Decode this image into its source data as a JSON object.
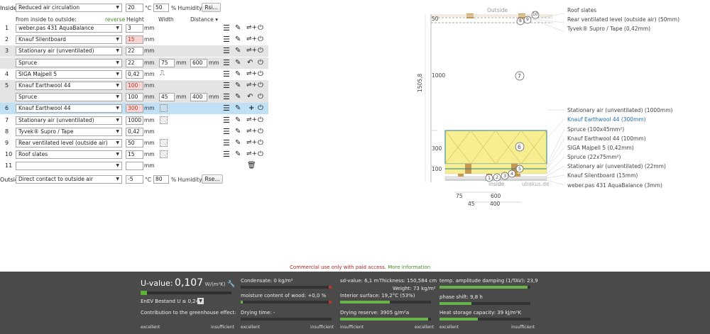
{
  "inside": {
    "label": "Inside:",
    "select": "Reduced air circulation",
    "temp": "20",
    "temp_unit": "°C",
    "humidity": "50",
    "hum_unit": "% Humidity",
    "btn": "Rsi..."
  },
  "headers": {
    "from_inside": "From inside to outside:",
    "reverse": "reverse",
    "height": "Height",
    "width": "Width",
    "distance": "Distance"
  },
  "layers": [
    {
      "num": "1",
      "material": "weber.pas 431 AquaBalance",
      "height": "3",
      "unit": "mm",
      "red": false,
      "bg": "white",
      "sub": false,
      "icon": "none"
    },
    {
      "num": "2",
      "material": "Knauf Silentboard",
      "height": "15",
      "unit": "mm",
      "red": true,
      "bg": "white",
      "sub": false,
      "icon": "none"
    },
    {
      "num": "3",
      "material": "Stationary air (unventilated)",
      "height": "22",
      "unit": "mm",
      "red": false,
      "bg": "grey",
      "sub": false,
      "icon": "none"
    },
    {
      "num": "",
      "material": "Spruce",
      "height": "22",
      "unit": "mm",
      "width": "75",
      "distance": "600",
      "red": false,
      "bg": "grey",
      "sub": true,
      "icon": "none"
    },
    {
      "num": "4",
      "material": "SIGA Majpell 5",
      "height": "0,42",
      "unit": "mm",
      "red": false,
      "bg": "white",
      "sub": false,
      "icon": "membrane"
    },
    {
      "num": "5",
      "material": "Knauf Earthwool 44",
      "height": "100",
      "unit": "mm",
      "red": true,
      "bg": "grey",
      "sub": false,
      "icon": "none"
    },
    {
      "num": "",
      "material": "Spruce",
      "height": "100",
      "unit": "mm",
      "width": "45",
      "distance": "400",
      "red": false,
      "bg": "grey",
      "sub": true,
      "icon": "none"
    },
    {
      "num": "6",
      "material": "Knauf Earthwool 44",
      "height": "300",
      "unit": "mm",
      "red": true,
      "bg": "blue",
      "sub": false,
      "icon": "grid"
    },
    {
      "num": "7",
      "material": "Stationary air (unventilated)",
      "height": "1000",
      "unit": "mm",
      "red": false,
      "bg": "white",
      "sub": false,
      "icon": "grid"
    },
    {
      "num": "8",
      "material": "Tyvek® Supro / Tape",
      "height": "0,42",
      "unit": "mm",
      "red": false,
      "bg": "white",
      "sub": false,
      "icon": "none"
    },
    {
      "num": "9",
      "material": "Rear ventilated level (outside air)",
      "height": "50",
      "unit": "mm",
      "red": false,
      "bg": "white",
      "sub": false,
      "icon": "grid"
    },
    {
      "num": "10",
      "material": "Roof slates",
      "height": "15",
      "unit": "mm",
      "red": false,
      "bg": "white",
      "sub": false,
      "icon": "grid"
    },
    {
      "num": "11",
      "material": "",
      "height": "",
      "unit": "mm",
      "red": false,
      "bg": "white",
      "sub": false,
      "icon": "trash"
    }
  ],
  "outside": {
    "label": "Outside",
    "select": "Direct contact to outside air",
    "temp": "-5",
    "temp_unit": "°C",
    "humidity": "80",
    "hum_unit": "% Humidity",
    "btn": "Rse..."
  },
  "diagram": {
    "top_outside": "Outside",
    "bottom_inside": "inside",
    "watermark": "ubakus.de",
    "left_scale": {
      "v50": "50",
      "v1000": "1000",
      "v300": "300",
      "v100": "100",
      "total": "1505,8"
    },
    "dims": {
      "d75": "75",
      "d600": "600",
      "d45": "45",
      "d400": "400"
    },
    "labels_top": [
      "Roof slates",
      "Rear ventilated level (outside air) (50mm)",
      "Tyvek® Supro / Tape (0,42mm)"
    ],
    "labels_right": [
      "Stationary air (unventilated) (1000mm)",
      "Knauf Earthwool 44 (300mm)",
      "Spruce (100x45mm²)",
      "Knauf Earthwool 44 (100mm)",
      "SIGA Majpell 5 (0,42mm)",
      "Spruce (22x75mm²)",
      "Stationary air (unventilated) (22mm)",
      "Knauf Silentboard (15mm)",
      "weber.pas 431 AquaBalance (3mm)"
    ],
    "circle_numbers": {
      "c1": "1",
      "c2": "2",
      "c3": "3",
      "c4": "4",
      "c5": "5",
      "c6": "6",
      "c7": "7",
      "c8": "8",
      "c9": "9",
      "c10": "10"
    }
  },
  "notice": {
    "text": "Commercial use only with paid access.",
    "link": "More information"
  },
  "results": {
    "uvalue_label": "U-value:",
    "uvalue": "0,107",
    "uvalue_unit": "W/(m²K)",
    "enev": "EnEV Bestand U ≤ 0,24",
    "contribution": "Contribution to the greenhouse effect:",
    "excellent": "excellent",
    "insufficient": "insufficient",
    "condensate": "Condensate: 0 kg/m²",
    "moisture": "moisture content of wood: +0,0 %",
    "drying_time": "Drying time: -",
    "sd_value": "sd-value: 6,1 m",
    "thickness": "Thickness: 150,584 cm",
    "weight": "Weight: 73 kg/m²",
    "interior_surface": "Interior surface: 19,2°C (53%)",
    "drying_reserve": "Drying reserve: 3905 g/m²a",
    "temp_damping": "temp. amplitude damping (1/TAV): 23,9",
    "phase_shift": "phase shift: 9,8 h",
    "heat_storage": "Heat storage capacity: 39 kJ/m²K",
    "uvalue_fill": 0.07,
    "bars": {
      "condensate": 0.0,
      "moisture": 0.02,
      "drying_time": 0.0,
      "interior": 0.55,
      "drying_reserve": 0.97,
      "damping": 0.97,
      "phase": 0.35,
      "heat": 0.42
    }
  }
}
